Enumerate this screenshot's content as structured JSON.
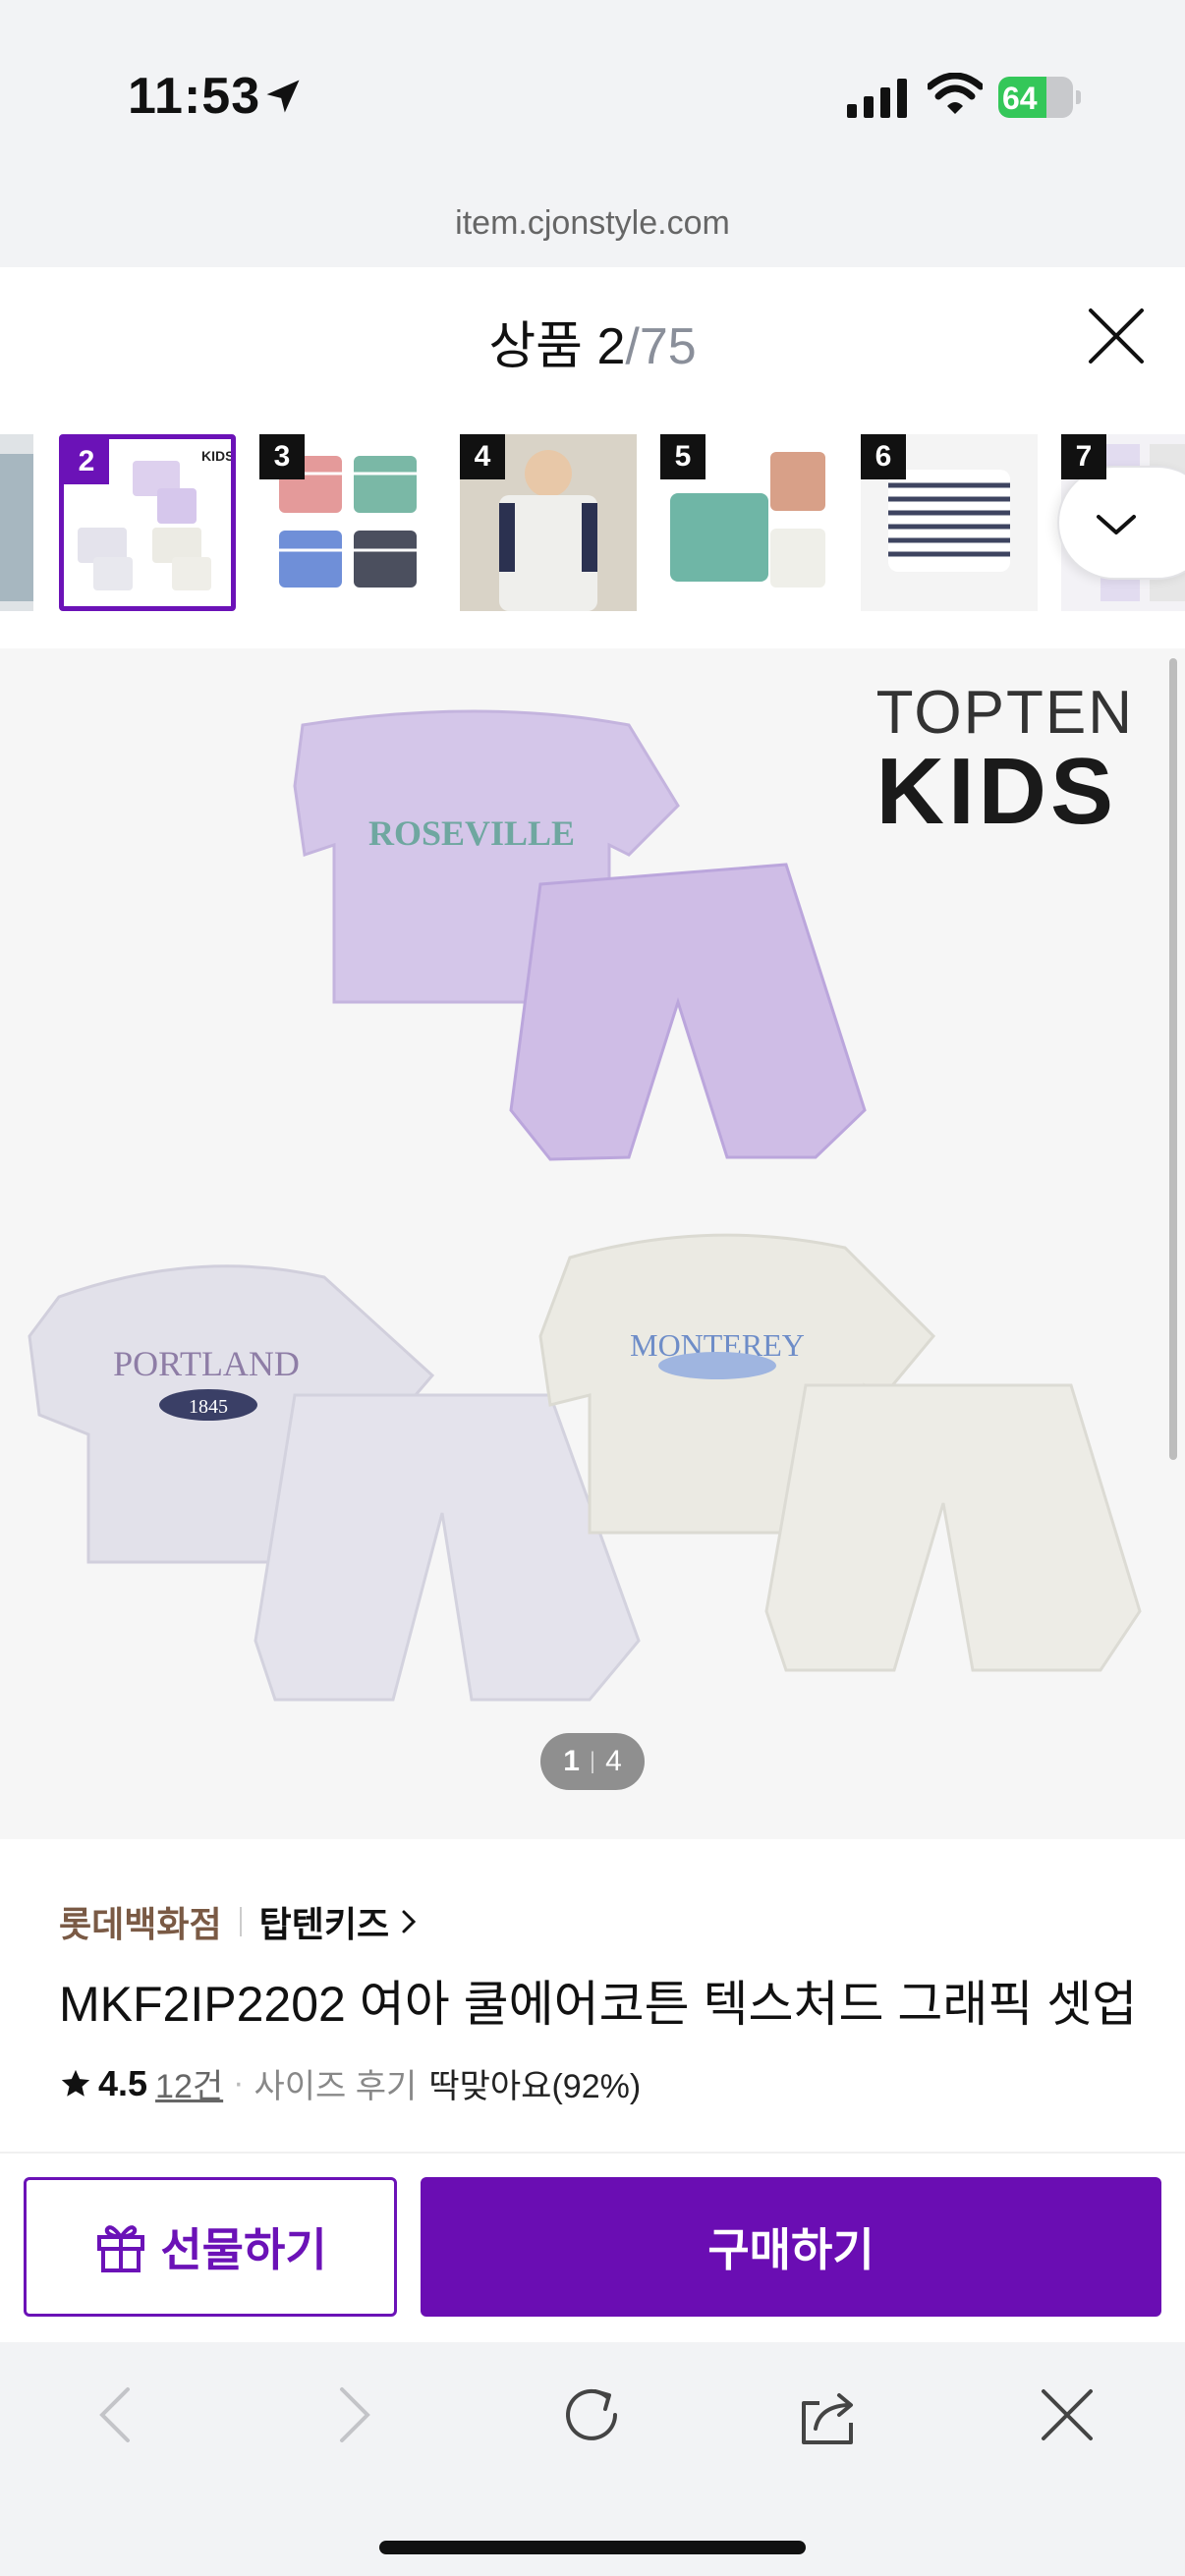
{
  "status_bar": {
    "time": "11:53",
    "battery": "64",
    "battery_level": 0.64
  },
  "browser": {
    "url": "item.cjonstyle.com"
  },
  "gallery": {
    "current": "2",
    "total": "75",
    "label": "상품",
    "thumbnails": [
      {
        "num": "2"
      },
      {
        "num": "3"
      },
      {
        "num": "4"
      },
      {
        "num": "5"
      },
      {
        "num": "6"
      },
      {
        "num": "7"
      }
    ]
  },
  "main_image": {
    "logo_line1": "TOPTEN",
    "logo_line2": "KIDS",
    "shirt1_text": "ROSEVILLE",
    "shirt2_text": "PORTLAND",
    "shirt2_sub": "1845",
    "shirt3_text": "MONTEREY",
    "pager_current": "1",
    "pager_total": "4"
  },
  "product": {
    "store": "롯데백화점",
    "brand": "탑텐키즈",
    "title": "MKF2IP2202 여아 쿨에어코튼 텍스처드 그래픽 셋업",
    "rating": "4.5",
    "review_count": "12건",
    "size_label": "사이즈 후기",
    "size_value": "딱맞아요(92%)"
  },
  "actions": {
    "gift": "선물하기",
    "buy": "구매하기"
  },
  "colors": {
    "accent": "#6a0db3",
    "store": "#7a5a45"
  },
  "icons": [
    "location-arrow-icon",
    "signal-icon",
    "wifi-icon",
    "battery-icon",
    "close-icon",
    "chevron-down-icon",
    "chevron-right-icon",
    "star-icon",
    "gift-icon",
    "back-icon",
    "forward-icon",
    "reload-icon",
    "share-icon"
  ]
}
